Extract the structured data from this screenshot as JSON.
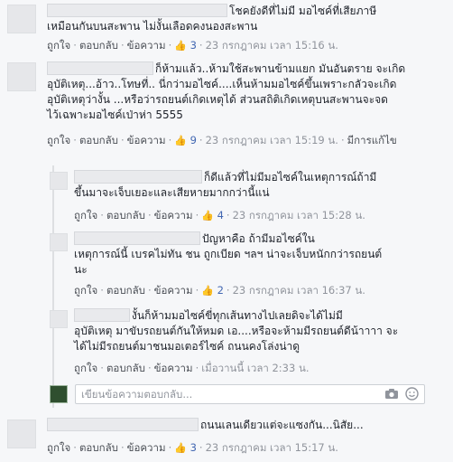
{
  "actions": {
    "like": "ถูกใจ",
    "reply": "ตอบกลับ",
    "message": "ข้อความ",
    "sep": "·",
    "edit_label": "มีการแก้ไข"
  },
  "comments": [
    {
      "lines": [
        "โชคยังดีที่ไม่มี มอไซค์ที่เสียภาษี",
        "เหมือนกันบนสะพาน ไม่งั้นเลือดคงนองสะพาน"
      ],
      "likes": "3",
      "time": "23 กรกฎาคม เวลา 15:16 น."
    },
    {
      "lines": [
        "ก็ห้ามแล้ว..ห้ามใช้สะพานข้ามแยก มันอันตราย จะเกิด",
        "อุบัติเหตุ...อ้าว..โทษที่.. นี่กว่ามอไซค์....เห็นห้ามมอไซค์ขึ้นเพราะกลัวจะเกิด",
        "อุบัติเหตุว่างั้น ...หรือว่ารถยนต์เกิดเหตุได้ ส่วนสถิติเกิดเหตุบนสะพานจะจด",
        "ไว้เฉพาะมอไซค์เป่าห่า 5555"
      ],
      "likes": "9",
      "time": "23 กรกฎาคม เวลา 15:19 น.",
      "edited": true
    },
    {
      "lines": [
        "ก็ดีแล้วที่ไม่มีมอไซค์ในเหตุการณ์ถ้ามี",
        "ขึ้นมาจะเจ็บเยอะและเสียหายมากกว่านี้แน่"
      ],
      "likes": "4",
      "time": "23 กรกฎาคม เวลา 15:28 น."
    },
    {
      "lines": [
        "ปัญหาคือ ถ้ามีมอไซค์ใน",
        "เหตุการณ์นี้ เบรคไม่ทัน ชน ถูกเบียด ฯลฯ น่าจะเจ็บหนักกว่ารถยนต์",
        "นะ"
      ],
      "likes": "2",
      "time": "23 กรกฎาคม เวลา 16:37 น."
    },
    {
      "lines": [
        "งั้นก็ห้ามมอไซค์ขี่ทุกเส้นทางไปเลยดิจะได้ไม่มี",
        "อุบัติเหตุ มาขับรถยนต์กันให้หมด เอ....หรือจะห้ามมีรถยนต์ดีน้าาาา จะ",
        "ได้ไม่มีรถยนต์มาชนมอเตอร์ไซค์ ถนนคงโล่งน่าดู"
      ],
      "time": "เมื่อวานนี้ เวลา 2:33 น."
    },
    {
      "lines": [
        "ถนนเลนเดียวแต่จะแซงกัน...นิสัย..."
      ],
      "likes": "3",
      "time": "23 กรกฎาคม เวลา 15:17 น."
    }
  ],
  "reply_input": {
    "placeholder": "เขียนข้อความตอบกลับ..."
  },
  "colors": {
    "link": "#4267b2",
    "meta": "#90949c",
    "background": "#f6f7f9"
  },
  "icons": [
    "thumbs-up-icon",
    "camera-icon",
    "smiley-icon"
  ]
}
